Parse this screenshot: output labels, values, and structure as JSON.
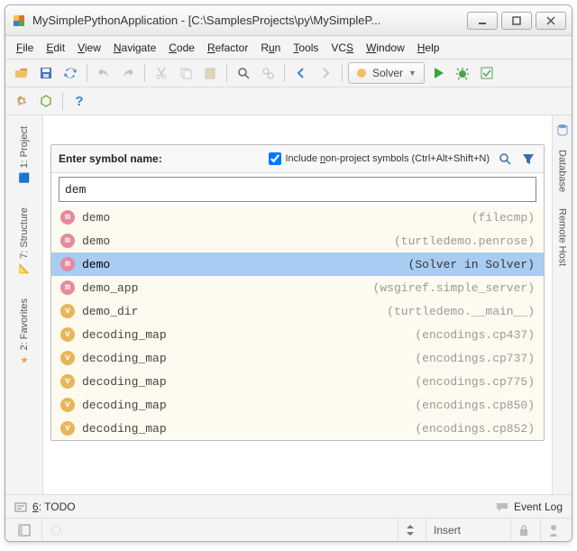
{
  "window": {
    "title": "MySimplePythonApplication - [C:\\SamplesProjects\\py\\MySimpleP..."
  },
  "menubar": {
    "file": "File",
    "edit": "Edit",
    "view": "View",
    "navigate": "Navigate",
    "code": "Code",
    "refactor": "Refactor",
    "run": "Run",
    "tools": "Tools",
    "vcs": "VCS",
    "window": "Window",
    "help": "Help"
  },
  "toolbar": {
    "runconfig_label": "Solver"
  },
  "left_tabs": {
    "project": "1: Project",
    "structure": "7: Structure",
    "favorites": "2: Favorites"
  },
  "right_tabs": {
    "database": "Database",
    "remote": "Remote Host"
  },
  "popup": {
    "prompt": "Enter symbol name:",
    "include_label": "Include non-project symbols (Ctrl+Alt+Shift+N)",
    "include_checked": true,
    "search_value": "dem"
  },
  "results": [
    {
      "badge": "m",
      "name": "demo",
      "loc": "(filecmp)",
      "selected": false
    },
    {
      "badge": "m",
      "name": "demo",
      "loc": "(turtledemo.penrose)",
      "selected": false
    },
    {
      "badge": "m",
      "name": "demo",
      "loc": "(Solver in Solver)",
      "selected": true
    },
    {
      "badge": "m",
      "name": "demo_app",
      "loc": "(wsgiref.simple_server)",
      "selected": false
    },
    {
      "badge": "v",
      "name": "demo_dir",
      "loc": "(turtledemo.__main__)",
      "selected": false
    },
    {
      "badge": "v",
      "name": "decoding_map",
      "loc": "(encodings.cp437)",
      "selected": false
    },
    {
      "badge": "v",
      "name": "decoding_map",
      "loc": "(encodings.cp737)",
      "selected": false
    },
    {
      "badge": "v",
      "name": "decoding_map",
      "loc": "(encodings.cp775)",
      "selected": false
    },
    {
      "badge": "v",
      "name": "decoding_map",
      "loc": "(encodings.cp850)",
      "selected": false
    },
    {
      "badge": "v",
      "name": "decoding_map",
      "loc": "(encodings.cp852)",
      "selected": false
    }
  ],
  "bottom": {
    "todo": "6: TODO",
    "eventlog": "Event Log"
  },
  "status": {
    "insert": "Insert"
  }
}
